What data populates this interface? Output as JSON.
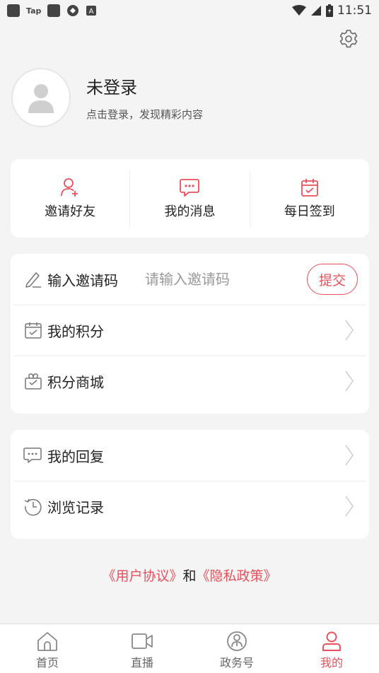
{
  "status_bar": {
    "tap_label": "Tap",
    "time": "11:51"
  },
  "profile": {
    "name": "未登录",
    "subtitle": "点击登录，发现精彩内容"
  },
  "quick_actions": [
    {
      "label": "邀请好友",
      "icon": "add-user-icon"
    },
    {
      "label": "我的消息",
      "icon": "message-icon"
    },
    {
      "label": "每日签到",
      "icon": "calendar-check-icon"
    }
  ],
  "menu1": {
    "invite": {
      "label": "输入邀请码",
      "placeholder": "请输入邀请码",
      "submit_label": "提交"
    },
    "points": {
      "label": "我的积分"
    },
    "mall": {
      "label": "积分商城"
    }
  },
  "menu2": {
    "replies": {
      "label": "我的回复"
    },
    "history": {
      "label": "浏览记录"
    }
  },
  "agreement": {
    "user_agreement": "《用户协议》",
    "and": "和",
    "privacy_policy": "《隐私政策》"
  },
  "tabs": [
    {
      "label": "首页",
      "icon": "home-icon",
      "active": false
    },
    {
      "label": "直播",
      "icon": "video-icon",
      "active": false
    },
    {
      "label": "政务号",
      "icon": "gov-icon",
      "active": false
    },
    {
      "label": "我的",
      "icon": "user-icon",
      "active": true
    }
  ],
  "colors": {
    "accent": "#e8505b",
    "background": "#f4f4f4"
  }
}
